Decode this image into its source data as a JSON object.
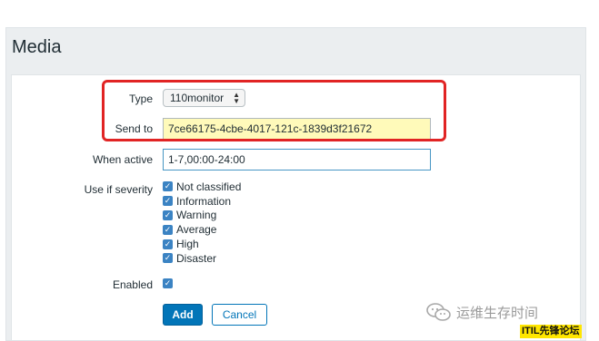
{
  "panel": {
    "title": "Media"
  },
  "form": {
    "type": {
      "label": "Type",
      "value": "110monitor"
    },
    "send_to": {
      "label": "Send to",
      "value": "7ce66175-4cbe-4017-121c-1839d3f21672"
    },
    "when_active": {
      "label": "When active",
      "value": "1-7,00:00-24:00"
    },
    "severity": {
      "label": "Use if severity",
      "items": [
        {
          "label": "Not classified",
          "checked": true
        },
        {
          "label": "Information",
          "checked": true
        },
        {
          "label": "Warning",
          "checked": true
        },
        {
          "label": "Average",
          "checked": true
        },
        {
          "label": "High",
          "checked": true
        },
        {
          "label": "Disaster",
          "checked": true
        }
      ]
    },
    "enabled": {
      "label": "Enabled",
      "checked": true
    }
  },
  "buttons": {
    "add": "Add",
    "cancel": "Cancel"
  },
  "watermark": {
    "text": "运维生存时间",
    "badge": "ITIL先锋论坛"
  },
  "colors": {
    "accent": "#0275b8",
    "highlight_box": "#e12424",
    "checkbox": "#3b83c3",
    "send_to_bg": "#fffaba"
  },
  "icons": {
    "checkbox": "check-icon",
    "select_arrows": "updown-arrows-icon",
    "watermark": "wechat-icon"
  }
}
